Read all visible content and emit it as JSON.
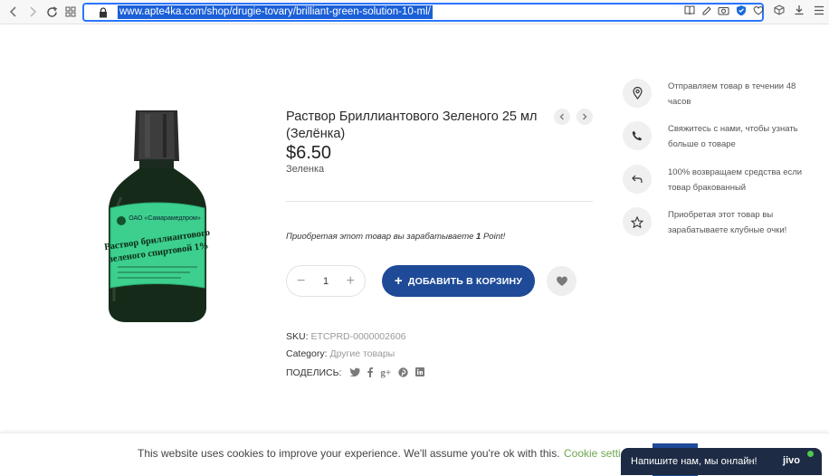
{
  "browser": {
    "url": "www.apte4ka.com/shop/drugie-tovary/brilliant-green-solution-10-ml/",
    "nav_icons": [
      "back-icon",
      "forward-icon",
      "reload-icon",
      "apps-grid-icon"
    ],
    "toolbar_icons": [
      "reader-icon",
      "edit-icon",
      "screenshot-icon",
      "shield-icon",
      "favorite-icon",
      "extensions-icon",
      "download-icon",
      "menu-icon"
    ]
  },
  "product": {
    "title": "Раствор Бриллиантового Зеленого 25 мл (Зелёнка)",
    "price": "$6.50",
    "subname": "Зеленка",
    "points_text": "Приобретая этот товар вы зарабатываете",
    "points_value": "1",
    "points_unit": "Point!",
    "quantity": "1",
    "add_to_cart_label": "ДОБАВИТЬ В КОРЗИНУ",
    "sku_label": "SKU:",
    "sku_value": "ETCPRD-0000002606",
    "category_label": "Category:",
    "category_value": "Другие товары",
    "share_label": "ПОДЕЛИСЬ:",
    "share_icons": [
      "twitter-icon",
      "facebook-icon",
      "google-plus-icon",
      "pinterest-icon",
      "linkedin-icon"
    ],
    "label_lines": [
      "ОАО «Самарамедпром»",
      "Раствор бриллиантового",
      "зеленого спиртовой 1%"
    ]
  },
  "features": [
    {
      "icon": "location-pin-icon",
      "text": "Отправляем товар в течении 48 часов"
    },
    {
      "icon": "phone-icon",
      "text": "Свяжитесь с нами, чтобы узнать больше о товаре"
    },
    {
      "icon": "return-arrow-icon",
      "text": "100% возвращаем средства если товар бракованный"
    },
    {
      "icon": "star-icon",
      "text": "Приобретая этот товар вы зарабатываете клубные очки!"
    }
  ],
  "cookie": {
    "text": "This website uses cookies to improve your experience. We'll assume you're ok with this.",
    "settings_link": "Cookie setti"
  },
  "chat": {
    "label": "Напишите нам, мы онлайн!",
    "brand": "jivo"
  },
  "colors": {
    "primary": "#1e4a98",
    "url_highlight": "#1a5fd8",
    "cookie_link": "#6aa84f",
    "chat_bg": "#1d2b44",
    "bottle_label": "#3ccf8e"
  }
}
